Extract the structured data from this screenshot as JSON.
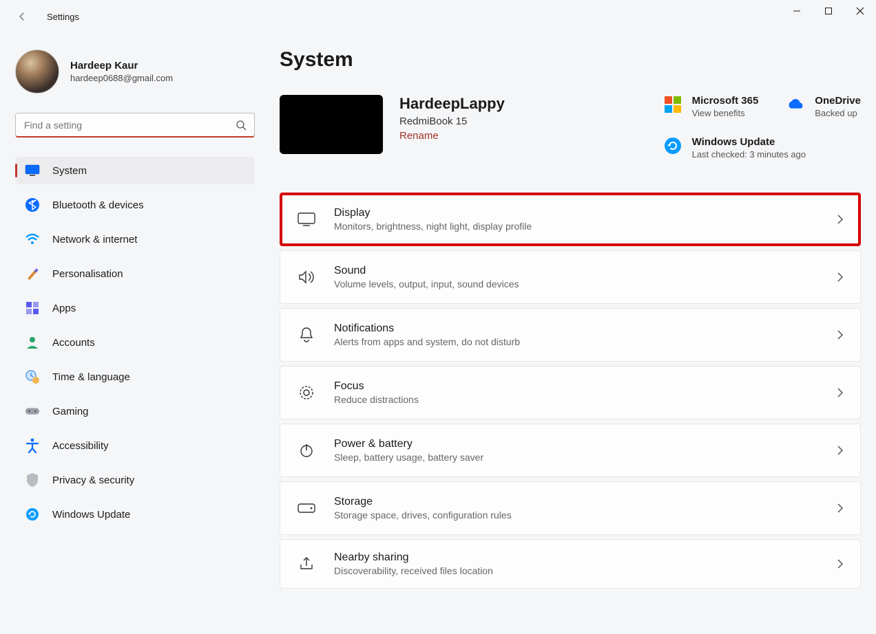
{
  "window": {
    "title": "Settings"
  },
  "user": {
    "name": "Hardeep Kaur",
    "email": "hardeep0688@gmail.com"
  },
  "search": {
    "placeholder": "Find a setting"
  },
  "sidebar": {
    "items": [
      {
        "label": "System"
      },
      {
        "label": "Bluetooth & devices"
      },
      {
        "label": "Network & internet"
      },
      {
        "label": "Personalisation"
      },
      {
        "label": "Apps"
      },
      {
        "label": "Accounts"
      },
      {
        "label": "Time & language"
      },
      {
        "label": "Gaming"
      },
      {
        "label": "Accessibility"
      },
      {
        "label": "Privacy & security"
      },
      {
        "label": "Windows Update"
      }
    ]
  },
  "page": {
    "title": "System"
  },
  "device": {
    "name": "HardeepLappy",
    "model": "RedmiBook 15",
    "rename_label": "Rename"
  },
  "right_info": {
    "m365": {
      "title": "Microsoft 365",
      "sub": "View benefits"
    },
    "onedrive": {
      "title": "OneDrive",
      "sub": "Backed up"
    },
    "update": {
      "title": "Windows Update",
      "sub": "Last checked: 3 minutes ago"
    }
  },
  "cards": [
    {
      "title": "Display",
      "desc": "Monitors, brightness, night light, display profile"
    },
    {
      "title": "Sound",
      "desc": "Volume levels, output, input, sound devices"
    },
    {
      "title": "Notifications",
      "desc": "Alerts from apps and system, do not disturb"
    },
    {
      "title": "Focus",
      "desc": "Reduce distractions"
    },
    {
      "title": "Power & battery",
      "desc": "Sleep, battery usage, battery saver"
    },
    {
      "title": "Storage",
      "desc": "Storage space, drives, configuration rules"
    },
    {
      "title": "Nearby sharing",
      "desc": "Discoverability, received files location"
    }
  ]
}
